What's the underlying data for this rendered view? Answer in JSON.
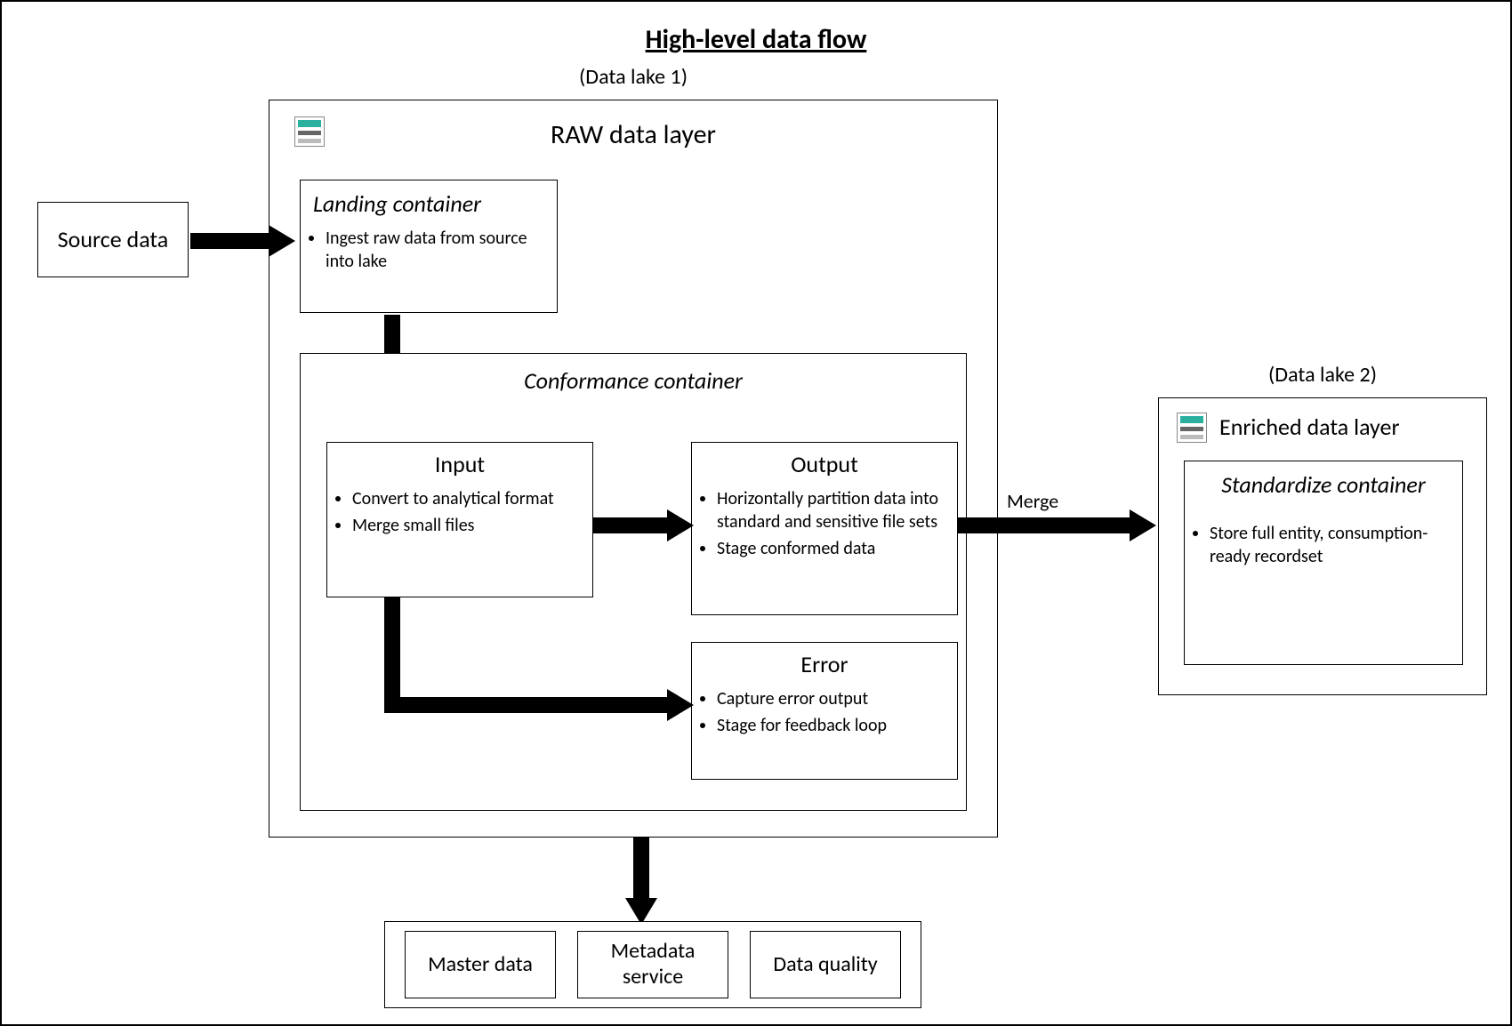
{
  "title": "High-level data flow",
  "datalake1_label": "(Data lake 1)",
  "datalake2_label": "(Data lake 2)",
  "raw_layer_title": "RAW data layer",
  "enriched_layer_title": "Enriched data layer",
  "source_box": "Source data",
  "landing": {
    "title": "Landing container",
    "b1": "Ingest raw data from source into lake"
  },
  "conformance": {
    "title": "Conformance container",
    "input": {
      "title": "Input",
      "b1": "Convert to analytical format",
      "b2": "Merge small files"
    },
    "output": {
      "title": "Output",
      "b1": "Horizontally partition data into standard and sensitive file sets",
      "b2": "Stage conformed data"
    },
    "error": {
      "title": "Error",
      "b1": "Capture error output",
      "b2": "Stage for feedback loop"
    }
  },
  "merge_label": "Merge",
  "standardize": {
    "title": "Standardize container",
    "b1": "Store full entity, consumption-ready recordset"
  },
  "services": {
    "s1": "Master data",
    "s2": "Metadata service",
    "s3": "Data quality"
  }
}
